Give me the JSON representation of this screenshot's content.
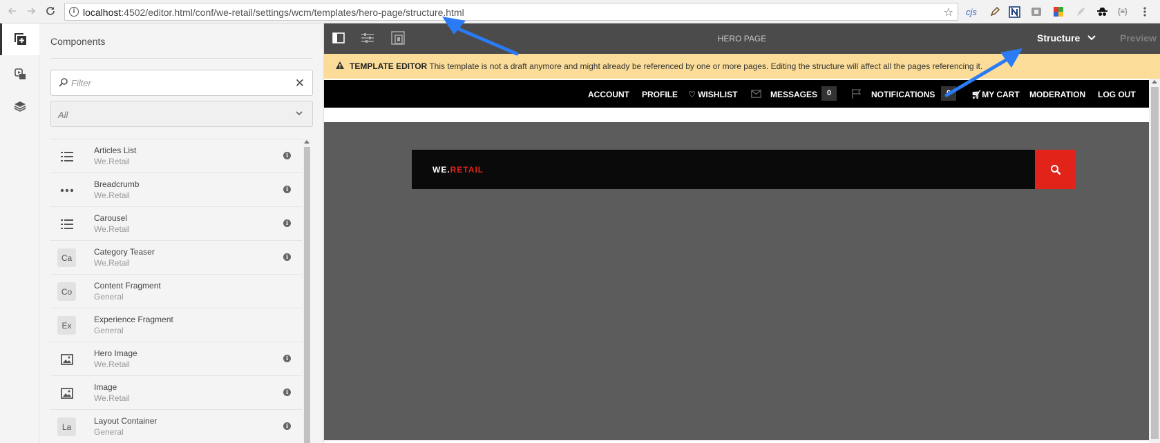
{
  "browser": {
    "url_host": "localhost",
    "url_rest": ":4502/editor.html/conf/we-retail/settings/wcm/templates/hero-page/structure.html",
    "extensions": [
      "cjs",
      "pen-icon",
      "n-icon",
      "puzzle-icon",
      "color-icon",
      "feather-icon",
      "spy-icon",
      "json-icon",
      "menu-icon"
    ],
    "ext_cjs_label": "cjs",
    "ext_json_label": "{≡}"
  },
  "rail": {
    "items": [
      "components-icon",
      "assets-icon",
      "content-tree-icon"
    ]
  },
  "panel": {
    "title": "Components",
    "filter_placeholder": "Filter",
    "group_select": "All",
    "components": [
      {
        "name": "Articles List",
        "group": "We.Retail",
        "icon": "list-icon",
        "abbr": "",
        "info": true
      },
      {
        "name": "Breadcrumb",
        "group": "We.Retail",
        "icon": "dots-icon",
        "abbr": "",
        "info": true
      },
      {
        "name": "Carousel",
        "group": "We.Retail",
        "icon": "list-icon",
        "abbr": "",
        "info": true
      },
      {
        "name": "Category Teaser",
        "group": "We.Retail",
        "icon": "abbr",
        "abbr": "Ca",
        "info": true
      },
      {
        "name": "Content Fragment",
        "group": "General",
        "icon": "abbr",
        "abbr": "Co",
        "info": false
      },
      {
        "name": "Experience Fragment",
        "group": "General",
        "icon": "abbr",
        "abbr": "Ex",
        "info": false
      },
      {
        "name": "Hero Image",
        "group": "We.Retail",
        "icon": "image-icon",
        "abbr": "",
        "info": true
      },
      {
        "name": "Image",
        "group": "We.Retail",
        "icon": "image-icon",
        "abbr": "",
        "info": true
      },
      {
        "name": "Layout Container",
        "group": "General",
        "icon": "abbr",
        "abbr": "La",
        "info": true
      }
    ],
    "info_glyph": "i"
  },
  "editor": {
    "page_title": "HERO PAGE",
    "mode": "Structure",
    "preview": "Preview",
    "alert_label": "TEMPLATE EDITOR",
    "alert_text": " This template is not a draft anymore and might already be referenced by one or more pages. Editing the structure will affect all the pages referencing it."
  },
  "site": {
    "nav": {
      "account": "ACCOUNT",
      "profile": "PROFILE",
      "wishlist": "WISHLIST",
      "messages": "MESSAGES",
      "messages_count": "0",
      "notifications": "NOTIFICATIONS",
      "notifications_count": "0",
      "cart": "MY CART",
      "moderation": "MODERATION",
      "logout": "LOG OUT"
    },
    "logo_white": "WE.",
    "logo_red": "RETAIL"
  },
  "colors": {
    "brand_red": "#e2231a",
    "toolbar": "#4b4b4b",
    "alert": "#fbdd99",
    "arrow": "#2a7bf4"
  }
}
